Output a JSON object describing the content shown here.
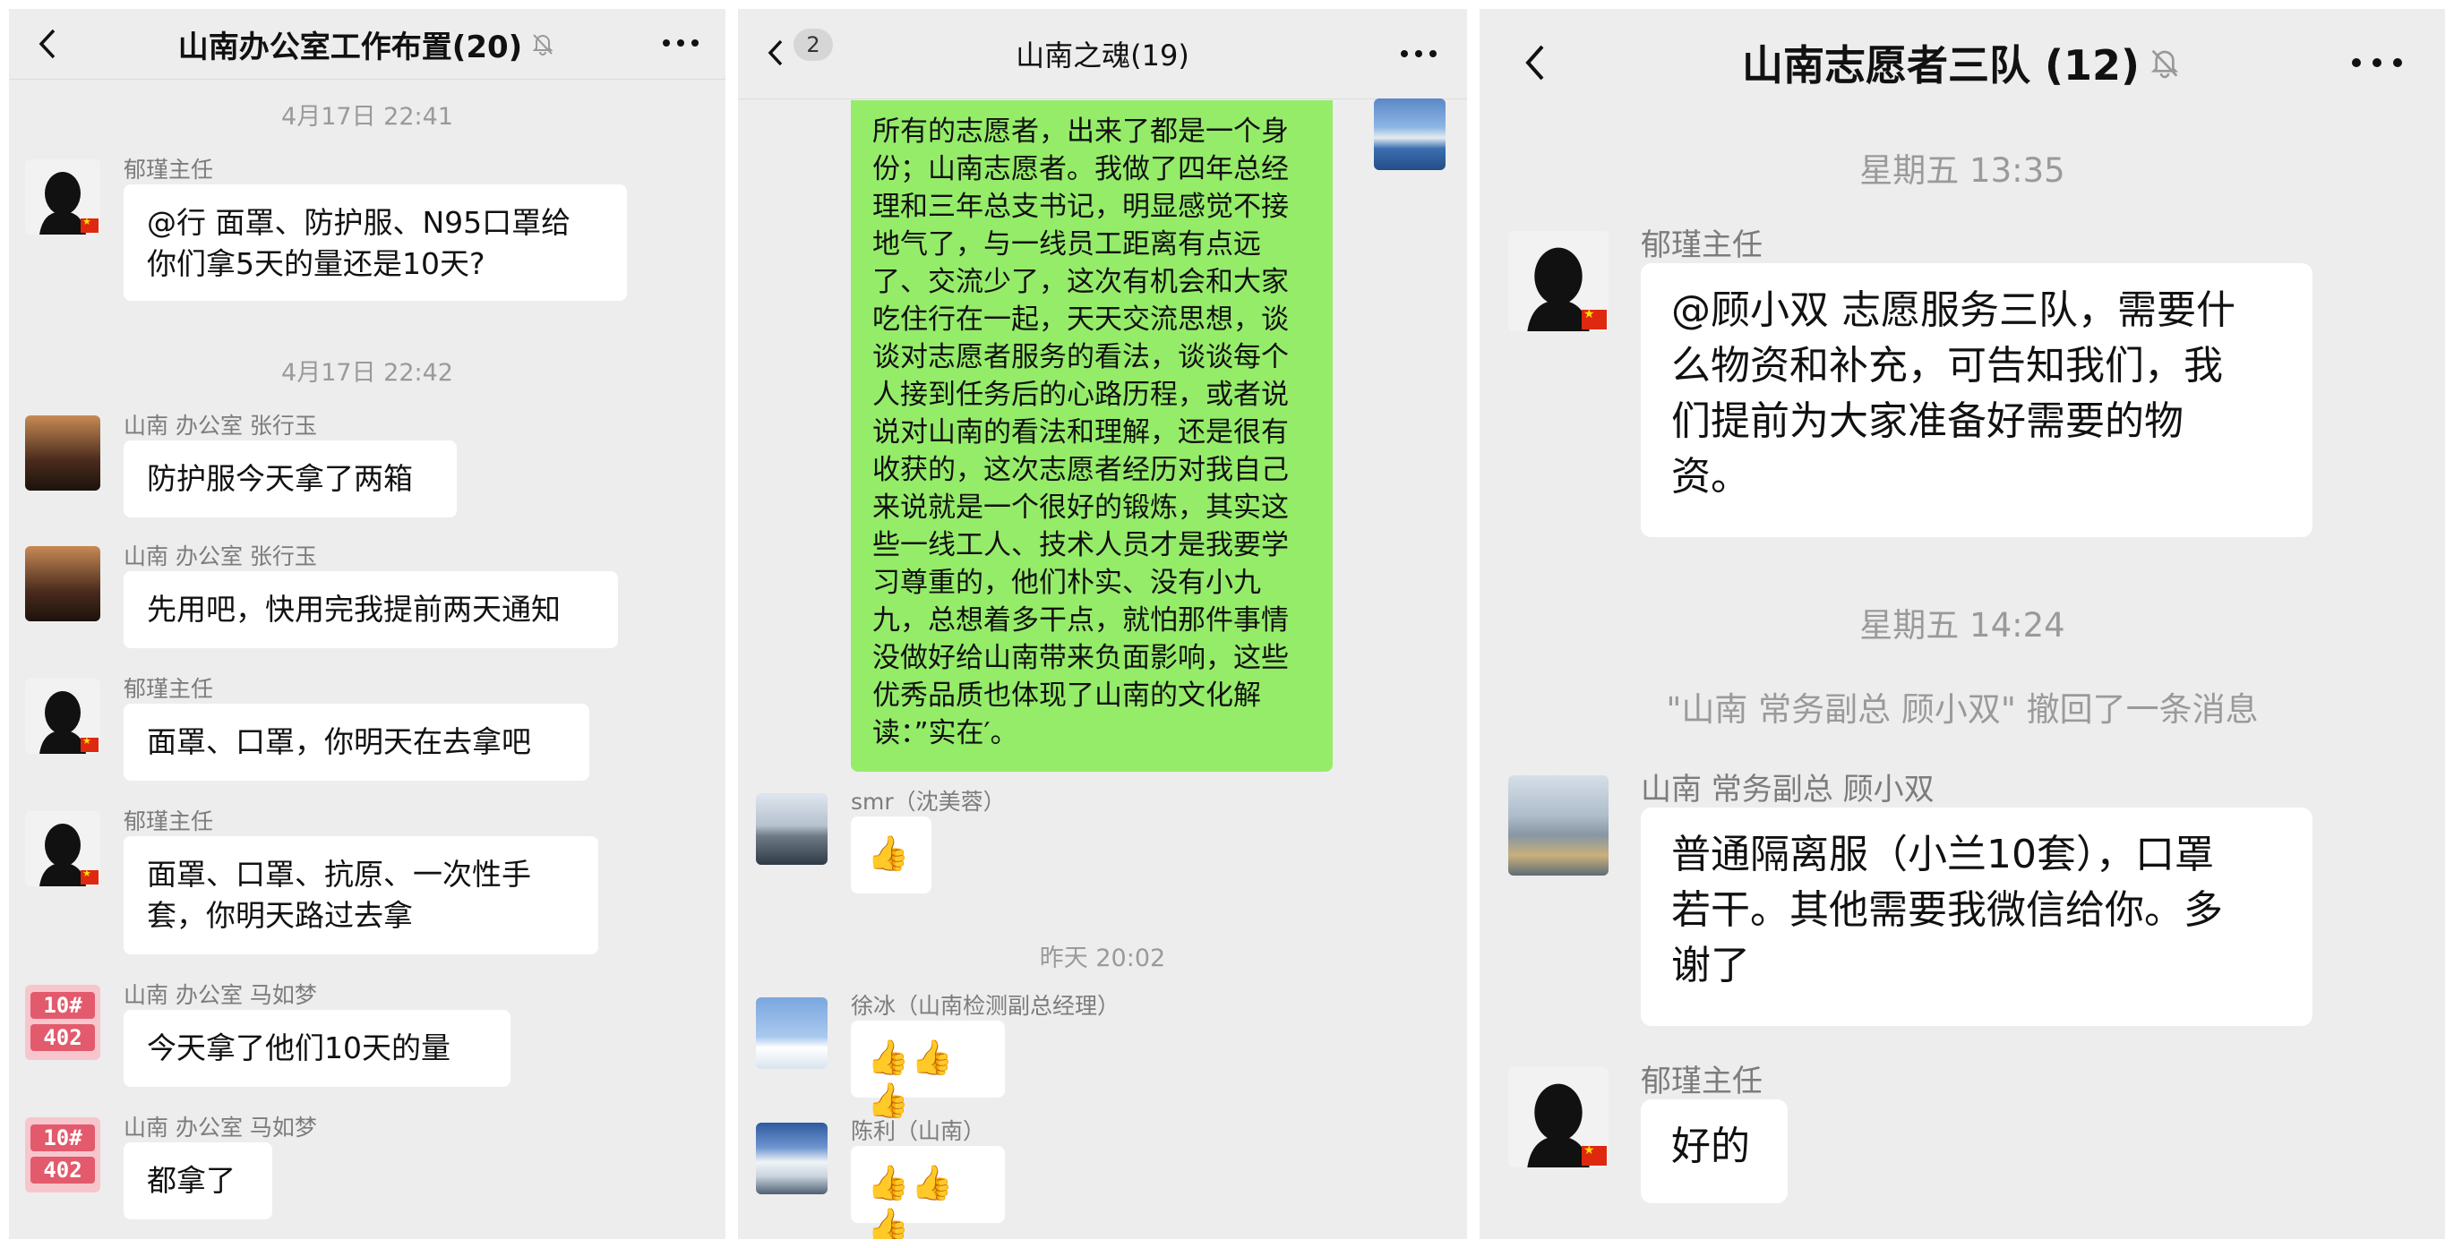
{
  "left": {
    "title": "山南办公室工作布置(20)",
    "timestamps": [
      "4月17日 22:41",
      "4月17日 22:42"
    ],
    "messages": [
      {
        "sender": "郁瑾主任",
        "text1": "@行 面罩、防护服、N95口罩给",
        "text2": "你们拿5天的量还是10天?"
      },
      {
        "sender": "山南 办公室 张行玉",
        "text1": "防护服今天拿了两箱"
      },
      {
        "sender": "山南 办公室 张行玉",
        "text1": "先用吧，快用完我提前两天通知"
      },
      {
        "sender": "郁瑾主任",
        "text1": "面罩、口罩，你明天在去拿吧"
      },
      {
        "sender": "郁瑾主任",
        "text1": "面罩、口罩、抗原、一次性手",
        "text2": "套，你明天路过去拿"
      },
      {
        "sender": "山南 办公室 马如梦",
        "text1": "今天拿了他们10天的量"
      },
      {
        "sender": "山南 办公室 马如梦",
        "text1": "都拿了"
      }
    ],
    "badge_top": "10#",
    "badge_bottom": "402"
  },
  "middle": {
    "title": "山南之魂(19)",
    "unread": "2",
    "long_lines": [
      "所有的志愿者，出来了都是一个身",
      "份；山南志愿者。我做了四年总经",
      "理和三年总支书记，明显感觉不接",
      "地气了，与一线员工距离有点远",
      "了、交流少了，这次有机会和大家",
      "吃住行在一起，天天交流思想，谈",
      "谈对志愿者服务的看法，谈谈每个",
      "人接到任务后的心路历程，或者说",
      "说对山南的看法和理解，还是很有",
      "收获的，这次志愿者经历对我自己",
      "来说就是一个很好的锻炼，其实这",
      "些一线工人、技术人员才是我要学",
      "习尊重的，他们朴实、没有小九",
      "九，总想着多干点，就怕那件事情",
      "没做好给山南带来负面影响，这些",
      "优秀品质也体现了山南的文化解",
      "读：”实在′。"
    ],
    "timestamp": "昨天 20:02",
    "senders": [
      "smr（沈美蓉）",
      "徐冰（山南检测副总经理）",
      "陈利（山南）"
    ],
    "thumbs": [
      "👍",
      "👍👍👍",
      "👍👍👍"
    ]
  },
  "right": {
    "title": "山南志愿者三队 (12)",
    "timestamps": [
      "星期五 13:35",
      "星期五 14:24"
    ],
    "system": "\"山南 常务副总 顾小双\" 撤回了一条消息",
    "messages": [
      {
        "sender": "郁瑾主任",
        "lines": [
          "@顾小双 志愿服务三队，需要什",
          "么物资和补充，可告知我们，我",
          "们提前为大家准备好需要的物",
          "资。"
        ]
      },
      {
        "sender": "山南 常务副总 顾小双",
        "lines": [
          "普通隔离服（小兰10套），口罩",
          "若干。其他需要我微信给你。多",
          "谢了"
        ]
      },
      {
        "sender": "郁瑾主任",
        "lines": [
          "好的"
        ]
      }
    ]
  }
}
